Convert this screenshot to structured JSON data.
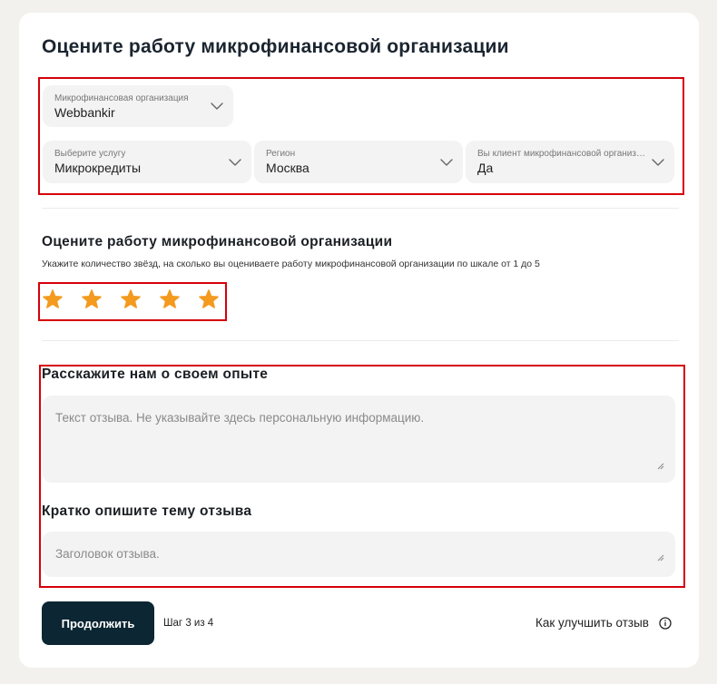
{
  "page": {
    "title": "Оцените работу микрофинансовой организации"
  },
  "selects": {
    "organization": {
      "label": "Микрофинансовая организация",
      "value": "Webbankir"
    },
    "service": {
      "label": "Выберите услугу",
      "value": "Микрокредиты"
    },
    "region": {
      "label": "Регион",
      "value": "Москва"
    },
    "client": {
      "label": "Вы клиент микрофинансовой организации?",
      "value": "Да"
    }
  },
  "rating": {
    "title": "Оцените работу микрофинансовой организации",
    "hint": "Укажите количество звёзд, на сколько вы оцениваете работу микрофинансовой организации по шкале от 1 до 5",
    "value": 5,
    "max": 5,
    "star_color": "#f39a1f"
  },
  "experience": {
    "title": "Расскажите нам о своем опыте",
    "placeholder": "Текст отзыва. Не указывайте здесь персональную информацию."
  },
  "topic": {
    "title": "Кратко опишите тему отзыва",
    "placeholder": "Заголовок отзыва."
  },
  "footer": {
    "continue_label": "Продолжить",
    "step_text": "Шаг 3 из 4",
    "improve_link": "Как улучшить отзыв"
  },
  "colors": {
    "highlight_border": "#d6000a",
    "primary_button": "#0c2633",
    "field_background": "#f3f3f3"
  },
  "icons": {
    "select_arrow": "chevron-down-icon",
    "rating": "star-icon",
    "help": "info-icon",
    "textarea_corner": "resize-handle-icon"
  }
}
